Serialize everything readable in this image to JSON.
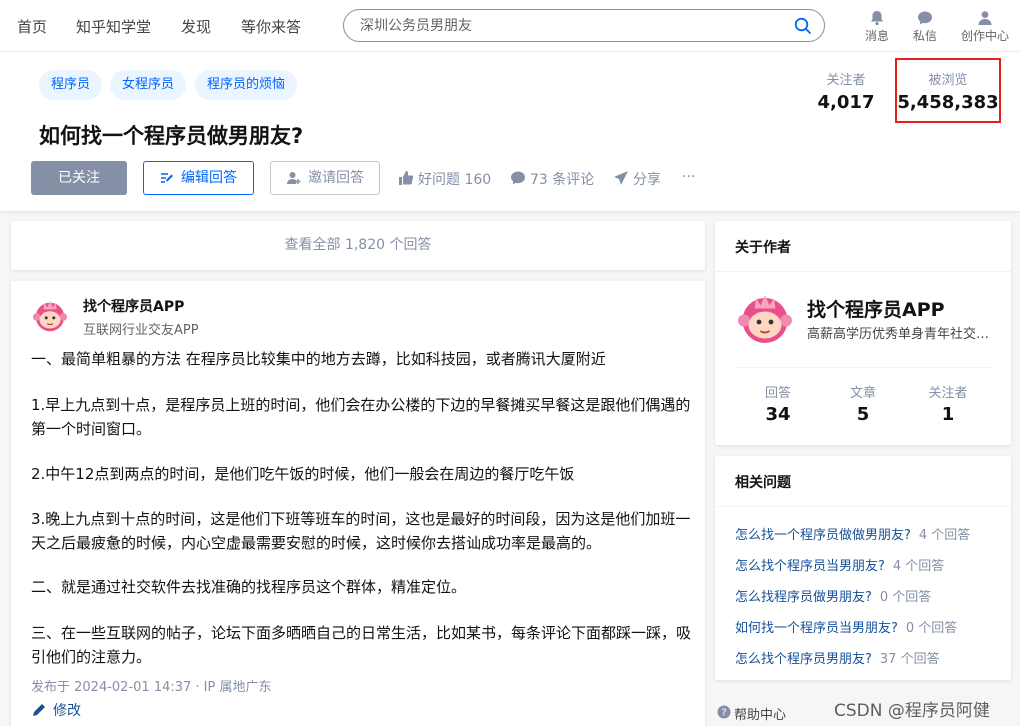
{
  "nav": {
    "links": [
      "首页",
      "知乎知学堂",
      "发现",
      "等你来答"
    ],
    "search_placeholder": "深圳公务员男朋友",
    "icons": [
      {
        "icon": "bell-icon",
        "label": "消息"
      },
      {
        "icon": "chat-icon",
        "label": "私信"
      },
      {
        "icon": "user-icon",
        "label": "创作中心"
      }
    ]
  },
  "question": {
    "tags": [
      "程序员",
      "女程序员",
      "程序员的烦恼"
    ],
    "title": "如何找一个程序员做男朋友?",
    "stats": {
      "followers_label": "关注者",
      "followers_value": "4,017",
      "views_label": "被浏览",
      "views_value": "5,458,383"
    },
    "buttons": {
      "followed": "已关注",
      "edit_answer": "编辑回答",
      "invite": "邀请回答"
    },
    "actions": {
      "good_question": "好问题 160",
      "comments": "73 条评论",
      "share": "分享",
      "more": "···"
    }
  },
  "view_all": "查看全部 1,820 个回答",
  "answer": {
    "author_name": "找个程序员APP",
    "author_bio": "互联网行业交友APP",
    "paragraphs": [
      "一、最简单粗暴的方法 在程序员比较集中的地方去蹲，比如科技园，或者腾讯大厦附近",
      "1.早上九点到十点，是程序员上班的时间，他们会在办公楼的下边的早餐摊买早餐这是跟他们偶遇的第一个时间窗口。",
      "2.中午12点到两点的时间，是他们吃午饭的时候，他们一般会在周边的餐厅吃午饭",
      "3.晚上九点到十点的时间，这是他们下班等班车的时间，这也是最好的时间段，因为这是他们加班一天之后最疲惫的时候，内心空虚最需要安慰的时候，这时候你去搭讪成功率是最高的。",
      "二、就是通过社交软件去找准确的找程序员这个群体，精准定位。",
      "三、在一些互联网的帖子，论坛下面多晒晒自己的日常生活，比如某书，每条评论下面都踩一踩，吸引他们的注意力。"
    ],
    "meta": "发布于 2024-02-01 14:37 · IP 属地广东",
    "edit_label": "修改"
  },
  "about_author": {
    "title": "关于作者",
    "name": "找个程序员APP",
    "bio": "高薪高学历优秀单身青年社交平台",
    "counters": [
      {
        "label": "回答",
        "value": "34"
      },
      {
        "label": "文章",
        "value": "5"
      },
      {
        "label": "关注者",
        "value": "1"
      }
    ]
  },
  "related": {
    "title": "相关问题",
    "items": [
      {
        "q": "怎么找一个程序员做做男朋友?",
        "count": "4 个回答"
      },
      {
        "q": "怎么找个程序员当男朋友?",
        "count": "4 个回答"
      },
      {
        "q": "怎么找程序员做男朋友?",
        "count": "0 个回答"
      },
      {
        "q": "如何找一个程序员当男朋友?",
        "count": "0 个回答"
      },
      {
        "q": "怎么找个程序员男朋友?",
        "count": "37 个回答"
      }
    ]
  },
  "footer": {
    "help": "帮助中心",
    "watermark": "CSDN @程序员阿健"
  },
  "colors": {
    "brand": "#0066ff",
    "link": "#175199",
    "highlight": "#e3201b",
    "muted": "#8590a6"
  }
}
